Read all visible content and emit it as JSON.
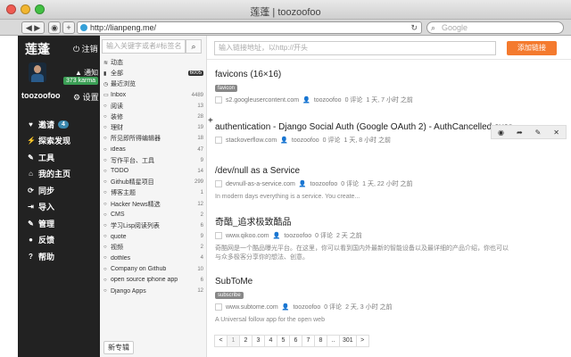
{
  "browser": {
    "title": "莲蓬 | toozoofoo",
    "url": "http://lianpeng.me/",
    "search_placeholder": "Google"
  },
  "sidebar": {
    "brand": "莲蓬",
    "logout": "注销",
    "notify": "通知",
    "karma": "373 karma",
    "username": "toozoofoo",
    "settings": "设置",
    "menu": [
      {
        "icon": "heart-icon",
        "glyph": "♥",
        "label": "邀请",
        "badge": "4"
      },
      {
        "icon": "bolt-icon",
        "glyph": "⚡",
        "label": "探索发现"
      },
      {
        "icon": "wrench-icon",
        "glyph": "✎",
        "label": "工具"
      },
      {
        "icon": "home-icon",
        "glyph": "⌂",
        "label": "我的主页"
      },
      {
        "icon": "sync-icon",
        "glyph": "⟳",
        "label": "同步"
      },
      {
        "icon": "import-icon",
        "glyph": "⇥",
        "label": "导入"
      },
      {
        "icon": "admin-icon",
        "glyph": "✎",
        "label": "管理"
      },
      {
        "icon": "comment-icon",
        "glyph": "●",
        "label": "反馈"
      },
      {
        "icon": "help-icon",
        "glyph": "?",
        "label": "帮助"
      }
    ]
  },
  "tags": {
    "search_placeholder": "输入关键字或者#标签名",
    "new_tag": "新专辑",
    "items": [
      {
        "icon": "activity-icon",
        "glyph": "≋",
        "name": "动态",
        "count": ""
      },
      {
        "icon": "bookmark-icon",
        "glyph": "▮",
        "name": "全部",
        "count": "6005",
        "active": true
      },
      {
        "icon": "clock-icon",
        "glyph": "◷",
        "name": "最近浏览",
        "count": ""
      },
      {
        "icon": "inbox-icon",
        "glyph": "▭",
        "name": "Inbox",
        "count": "4489"
      },
      {
        "icon": "tag-icon",
        "glyph": "○",
        "name": "阅读",
        "count": "13"
      },
      {
        "icon": "tag-icon",
        "glyph": "○",
        "name": "装修",
        "count": "28"
      },
      {
        "icon": "tag-icon",
        "glyph": "○",
        "name": "理财",
        "count": "19"
      },
      {
        "icon": "tag-icon",
        "glyph": "○",
        "name": "所见即所得编辑器",
        "count": "18"
      },
      {
        "icon": "tag-icon",
        "glyph": "○",
        "name": "ideas",
        "count": "47"
      },
      {
        "icon": "tag-icon",
        "glyph": "○",
        "name": "写作平台、工具",
        "count": "9"
      },
      {
        "icon": "tag-icon",
        "glyph": "○",
        "name": "TODO",
        "count": "14"
      },
      {
        "icon": "tag-icon",
        "glyph": "○",
        "name": "Github精星项目",
        "count": "299"
      },
      {
        "icon": "tag-icon",
        "glyph": "○",
        "name": "博客主题",
        "count": "1"
      },
      {
        "icon": "tag-icon",
        "glyph": "○",
        "name": "Hacker News精选",
        "count": "12"
      },
      {
        "icon": "tag-icon",
        "glyph": "○",
        "name": "CMS",
        "count": "2"
      },
      {
        "icon": "tag-icon",
        "glyph": "○",
        "name": "学习Lisp阅读列表",
        "count": "6"
      },
      {
        "icon": "tag-icon",
        "glyph": "○",
        "name": "quote",
        "count": "9"
      },
      {
        "icon": "tag-icon",
        "glyph": "○",
        "name": "视频",
        "count": "2"
      },
      {
        "icon": "tag-icon",
        "glyph": "○",
        "name": "dotfiles",
        "count": "4"
      },
      {
        "icon": "tag-icon",
        "glyph": "○",
        "name": "Company on Github",
        "count": "10"
      },
      {
        "icon": "tag-icon",
        "glyph": "○",
        "name": "open source iphone app",
        "count": "6"
      },
      {
        "icon": "tag-icon",
        "glyph": "○",
        "name": "Django Apps",
        "count": "12"
      }
    ]
  },
  "main": {
    "link_placeholder": "输入链接地址，以http://开头",
    "add_button": "添加链接",
    "items": [
      {
        "title": "favicons (16×16)",
        "tag": "favicon",
        "domain": "s2.googleusercontent.com",
        "user": "toozoofoo",
        "comments": "0 评论",
        "time": "1 天, 7 小时 之前",
        "desc": ""
      },
      {
        "title": "authentication - Django Social Auth (Google OAuth 2) - AuthCancelled ever",
        "tag": "",
        "domain": "stackoverflow.com",
        "user": "toozoofoo",
        "comments": "0 评论",
        "time": "1 天, 8 小时 之前",
        "desc": ""
      },
      {
        "title": "/dev/null as a Service",
        "tag": "",
        "domain": "devnull-as-a-service.com",
        "user": "toozoofoo",
        "comments": "0 评论",
        "time": "1 天, 22 小时 之前",
        "desc": "In modern days everything is a service. You create..."
      },
      {
        "title": "奇酷_追求极致酷品",
        "tag": "",
        "domain": "www.qikoo.com",
        "user": "toozoofoo",
        "comments": "0 评论",
        "time": "2 天 之前",
        "desc": "奇酷网是一个酷品曝光平台。在这里，你可以看到国内外最新的智能设备以及最详细的产品介绍，你也可以与众多极客分享你的想法、创意。"
      },
      {
        "title": "SubToMe",
        "tag": "subscribe",
        "domain": "www.subtome.com",
        "user": "toozoofoo",
        "comments": "0 评论",
        "time": "2 天, 3 小时 之前",
        "desc": "A Universal follow app for the open web"
      }
    ],
    "pages": [
      "<",
      "1",
      "2",
      "3",
      "4",
      "5",
      "6",
      "7",
      "8",
      "..",
      "301",
      ">"
    ]
  }
}
